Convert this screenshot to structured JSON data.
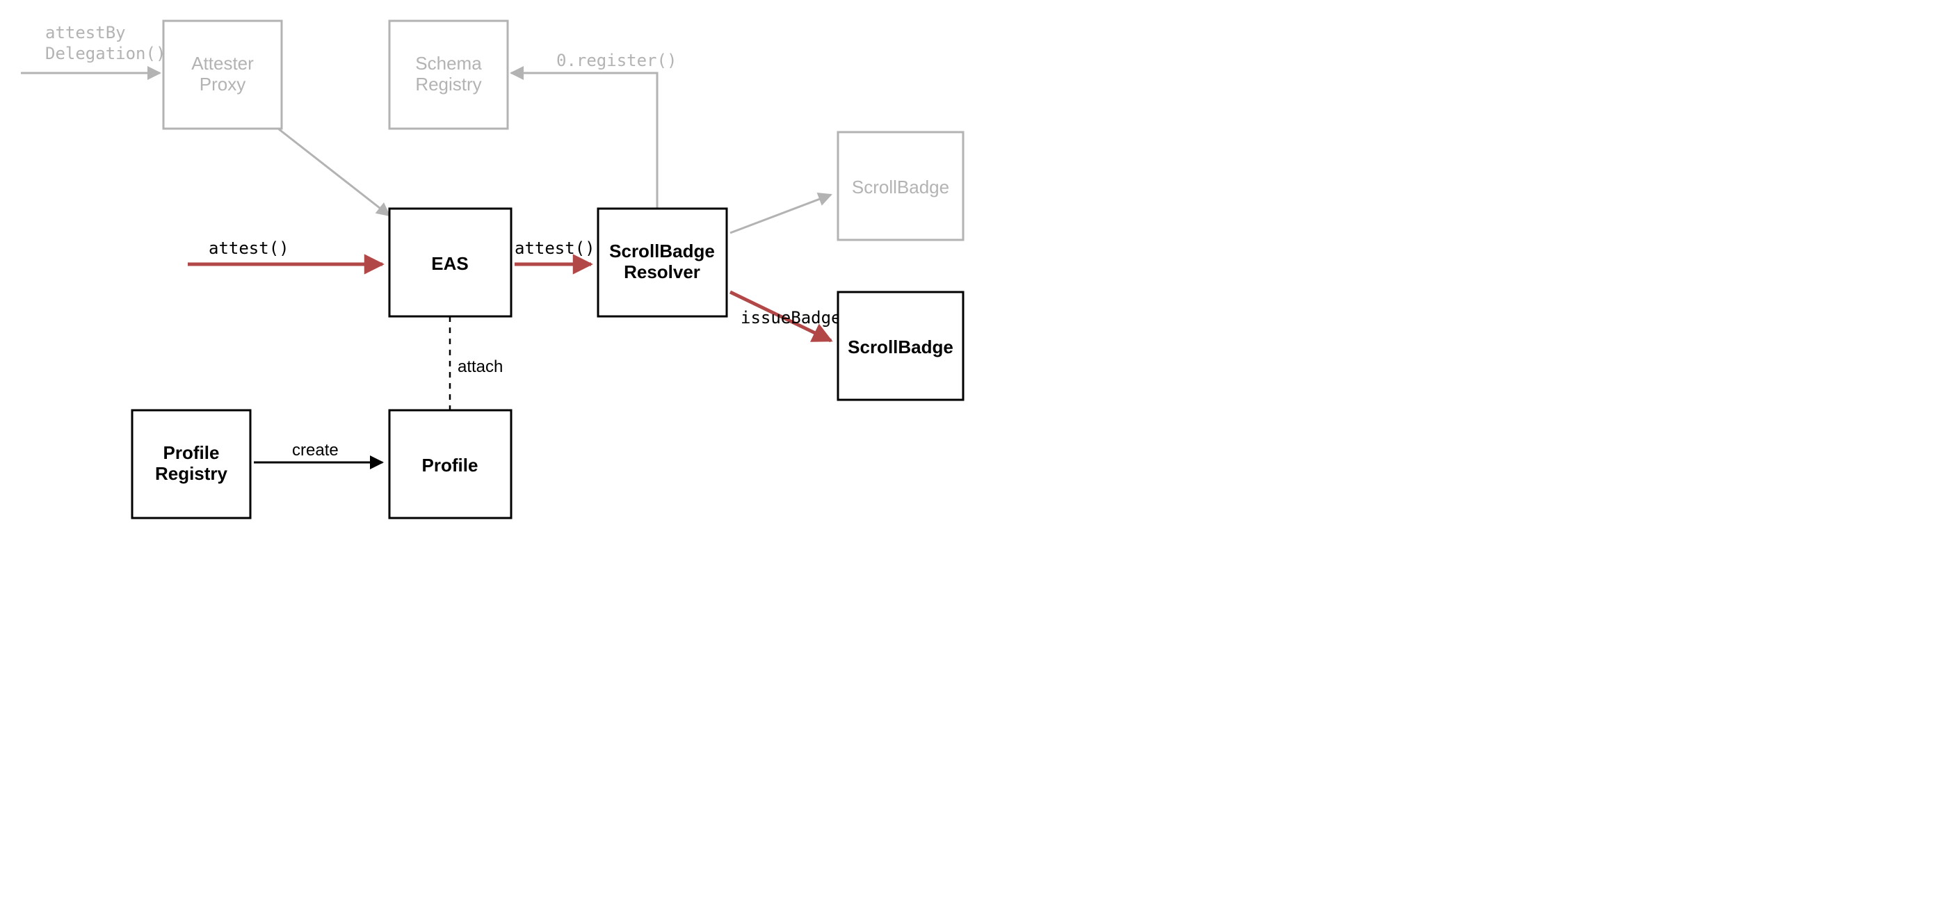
{
  "nodes": {
    "attesterProxy": {
      "line1": "Attester",
      "line2": "Proxy"
    },
    "schemaRegistry": {
      "line1": "Schema",
      "line2": "Registry"
    },
    "eas": {
      "label": "EAS"
    },
    "scrollBadgeResolver": {
      "line1": "ScrollBadge",
      "line2": "Resolver"
    },
    "scrollBadgeMuted": {
      "label": "ScrollBadge"
    },
    "scrollBadge": {
      "label": "ScrollBadge"
    },
    "profileRegistry": {
      "line1": "Profile",
      "line2": "Registry"
    },
    "profile": {
      "label": "Profile"
    }
  },
  "edges": {
    "attestByDelegation": {
      "line1": "attestBy",
      "line2": "Delegation()"
    },
    "register": "0.register()",
    "attestToEas": "attest()",
    "attestToResolver": "attest()",
    "issueBadge": "issueBadge()",
    "attach": "attach",
    "create": "create"
  },
  "colors": {
    "muted": "#b3b3b3",
    "active": "#000000",
    "highlight": "#b24747"
  }
}
